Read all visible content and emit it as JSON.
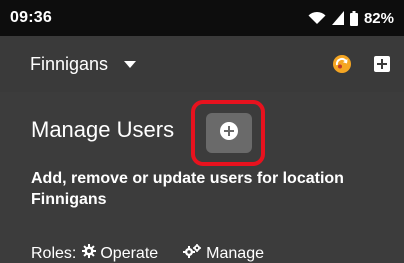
{
  "status_bar": {
    "time": "09:36",
    "battery": "82%",
    "icons": [
      "wifi-icon",
      "signal-icon",
      "battery-icon"
    ]
  },
  "app_bar": {
    "location": "Finnigans",
    "actions": [
      "sync-icon",
      "add-icon"
    ]
  },
  "main": {
    "title": "Manage Users",
    "description": "Add, remove or update users for location Finnigans",
    "roles_label": "Roles:",
    "roles": [
      {
        "icon": "gear-icon",
        "label": "Operate"
      },
      {
        "icon": "gears-icon",
        "label": "Manage"
      }
    ]
  },
  "colors": {
    "status_bar_bg": "#0d0d0d",
    "background": "#3c3c3c",
    "highlight": "#e8121e",
    "accent": "#f5a623"
  }
}
